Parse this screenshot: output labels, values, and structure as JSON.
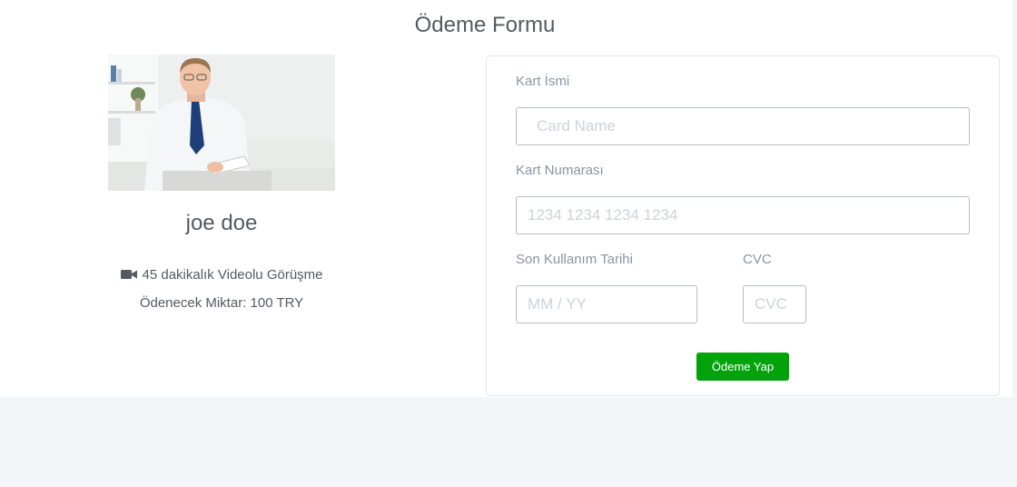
{
  "page": {
    "title": "Ödeme Formu"
  },
  "profile": {
    "name": "joe doe",
    "session_text": "45 dakikalık Videolu Görüşme",
    "amount_text": "Ödenecek Miktar: 100 TRY"
  },
  "form": {
    "card_name_label": "Kart İsmi",
    "card_name_placeholder": "Card Name",
    "card_number_label": "Kart Numarası",
    "card_number_placeholder": "1234 1234 1234 1234",
    "expiry_label": "Son Kullanım Tarihi",
    "expiry_placeholder": "MM / YY",
    "cvc_label": "CVC",
    "cvc_placeholder": "CVC",
    "submit_label": "Ödeme Yap"
  },
  "colors": {
    "primary_button": "#02a20a",
    "text": "#575962",
    "label": "#8c93a3",
    "background": "#f4f5f8"
  },
  "icons": {
    "session": "video-camera-icon"
  }
}
